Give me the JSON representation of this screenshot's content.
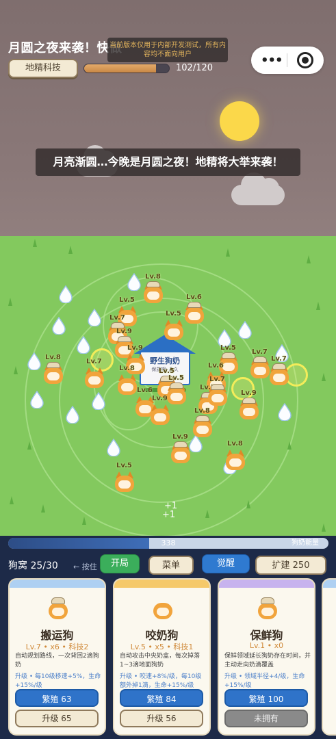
{
  "header": {
    "title": "月圆之夜来袭！快做",
    "dev_notice": "当前版本仅用于内部开发测试，所有内容均不面向用户",
    "tech_button": "地精科技",
    "tech_progress": "102/120",
    "tech_progress_fraction": 0.85,
    "capsule_more": "•••"
  },
  "banner": {
    "text": "月亮渐圆…今晚是月圆之夜！地精将大举来袭！"
  },
  "field": {
    "house_name": "野生狗奶",
    "house_sub": "保质期: 永久",
    "plus_one_a": "+1",
    "plus_one_b": "+1",
    "dog_levels": [
      "Lv.8",
      "Lv.5",
      "Lv.6",
      "Lv.7",
      "Lv.5",
      "Lv.9",
      "Lv.9",
      "Lv.5",
      "Lv.8",
      "Lv.7",
      "Lv.7",
      "Lv.6",
      "Lv.5",
      "Lv.8",
      "Lv.7",
      "Lv.6",
      "Lv.9",
      "Lv.9",
      "Lv.5",
      "Lv.8",
      "Lv.9",
      "Lv.8",
      "Lv.5",
      "Lv.7",
      "Lv.7"
    ]
  },
  "energy": {
    "value": "338",
    "label": "狗奶能量",
    "fraction": 0.44
  },
  "controls": {
    "kennel": "狗窝 25/30",
    "hint": "← 按住",
    "open_label": "开局",
    "menu_label": "菜单",
    "awaken_label": "觉醒",
    "expand_label": "扩建 250"
  },
  "cards": [
    {
      "name": "搬运狗",
      "stats": "Lv.7 • x6 • 科技2",
      "desc": "自动规划路线，一次背回2滴狗奶",
      "upgrade_info": "升级 • 每10级移速+5%，生命+15%/级",
      "breed_label": "繁殖 63",
      "upgrade_label": "升级 65",
      "strip_color": "#aed0f2"
    },
    {
      "name": "咬奶狗",
      "stats": "Lv.5 • x5 • 科技1",
      "desc": "自动攻击中央奶盒，每次掉落1~3滴地面狗奶",
      "upgrade_info": "升级 • 咬速+8%/级，每10级额外掉1滴，生命+15%/级",
      "breed_label": "繁殖 84",
      "upgrade_label": "升级 56",
      "strip_color": "#f5c96a"
    },
    {
      "name": "保鲜狗",
      "stats": "Lv.1 • x0",
      "desc": "保鲜领域延长狗奶存在时间，并主动走向奶滴覆盖",
      "upgrade_info": "升级 • 领域半径+4/级，生命+15%/级",
      "breed_label": "繁殖 100",
      "upgrade_label": "未拥有",
      "strip_color": "#c7b3ee"
    }
  ]
}
